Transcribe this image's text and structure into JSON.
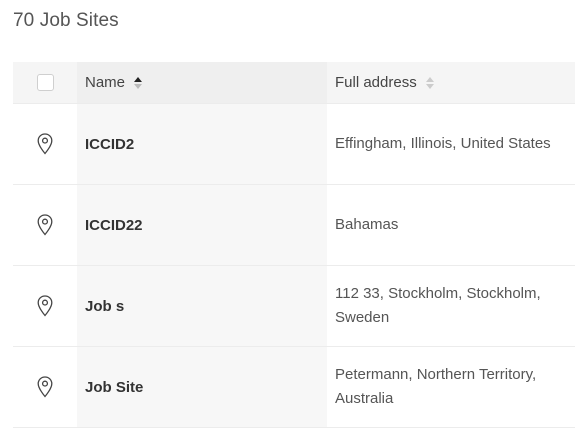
{
  "page": {
    "title": "70 Job Sites"
  },
  "table": {
    "columns": [
      {
        "label": "Name",
        "sort": "ascending"
      },
      {
        "label": "Full address",
        "sort": "none"
      }
    ],
    "rows": [
      {
        "icon": "location-pin-icon",
        "name": "ICCID2",
        "address": "Effingham, Illinois, United States"
      },
      {
        "icon": "location-pin-icon",
        "name": "ICCID22",
        "address": "Bahamas"
      },
      {
        "icon": "location-pin-icon",
        "name": "Job s",
        "address": "112 33, Stockholm, Stockholm, Sweden"
      },
      {
        "icon": "location-pin-icon",
        "name": "Job Site",
        "address": "Petermann, Northern Territory, Australia"
      }
    ]
  },
  "colors": {
    "header_bg": "#f5f5f5",
    "name_column_bg": "#f7f7f7",
    "border": "#ececec"
  }
}
